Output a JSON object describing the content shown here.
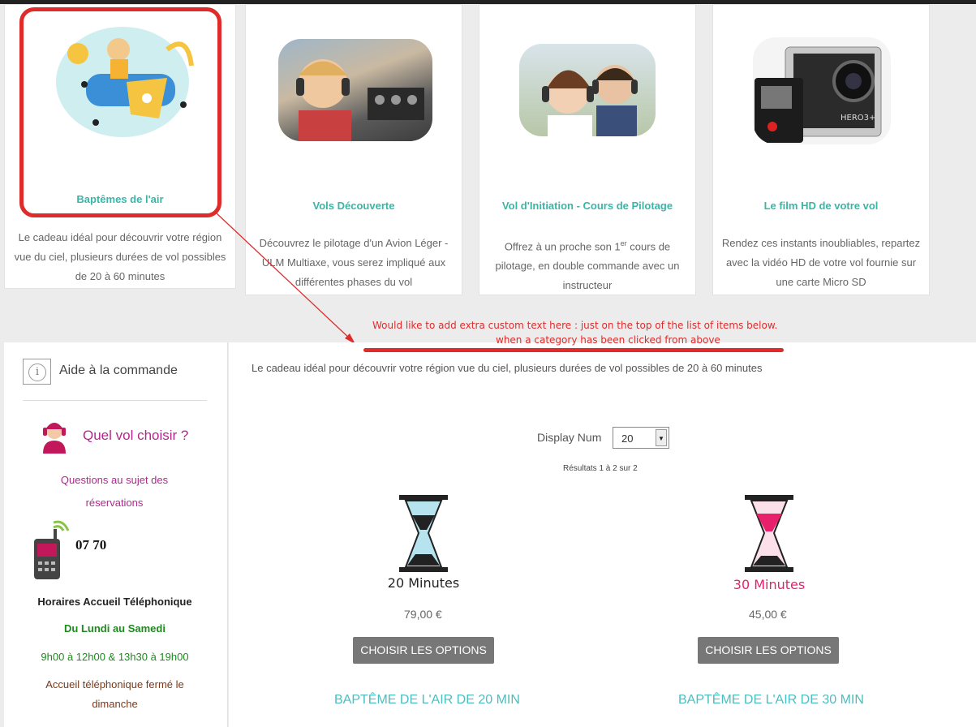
{
  "cards": [
    {
      "title": "Baptêmes de l'air",
      "desc": [
        "Le cadeau idéal pour découvrir votre région",
        "vue du ciel, plusieurs durées de vol possibles",
        "de 20 à 60 minutes"
      ]
    },
    {
      "title": "Vols Découverte",
      "desc": [
        "Découvrez le pilotage d'un Avion Léger -",
        "ULM Multiaxe, vous serez impliqué aux",
        "différentes phases du vol"
      ]
    },
    {
      "title": "Vol d'Initiation - Cours de Pilotage",
      "desc_pre": "Offrez à un proche son 1",
      "desc_sup": "er",
      "desc_post": " cours de",
      "desc": [
        "pilotage, en double commande avec un",
        "instructeur"
      ]
    },
    {
      "title": "Le film HD de votre vol",
      "desc": [
        "Rendez ces instants inoubliables, repartez",
        "avec la vidéo HD de votre vol fournie sur",
        "une carte Micro SD"
      ]
    }
  ],
  "annotation": {
    "line1": "Would like to add extra custom text here : just on the top of the list of items below.",
    "line2": "when a category has been clicked from above"
  },
  "sidebar": {
    "aide_title": "Aide à la commande",
    "choose_title": "Quel vol choisir ?",
    "questions": [
      "Questions au sujet des",
      "réservations"
    ],
    "phone": "07 70",
    "hours_title": "Horaires Accueil Téléphonique",
    "days": "Du Lundi au Samedi",
    "hours": "9h00 à 12h00 & 13h30 à 19h00",
    "closed": [
      "Accueil téléphonique fermé le",
      "dimanche"
    ]
  },
  "main": {
    "category_desc": "Le cadeau idéal pour découvrir votre région vue du ciel, plusieurs durées de vol possibles de 20 à 60 minutes",
    "display_label": "Display Num",
    "display_value": "20",
    "results": "Résultats 1 à 2 sur 2",
    "products": [
      {
        "img_label": "20 Minutes",
        "price": "79,00 €",
        "button": "CHOISIR LES OPTIONS",
        "name": "BAPTÊME DE L'AIR DE 20 MIN"
      },
      {
        "img_label": "30 Minutes",
        "price": "45,00 €",
        "button": "CHOISIR LES OPTIONS",
        "name": "BAPTÊME DE L'AIR DE 30 MIN"
      }
    ]
  },
  "colors": {
    "accent": "#3bb5a6",
    "annotation": "#e02b2b",
    "sidebar_purple": "#b0288c",
    "green": "#1e8a1e"
  }
}
